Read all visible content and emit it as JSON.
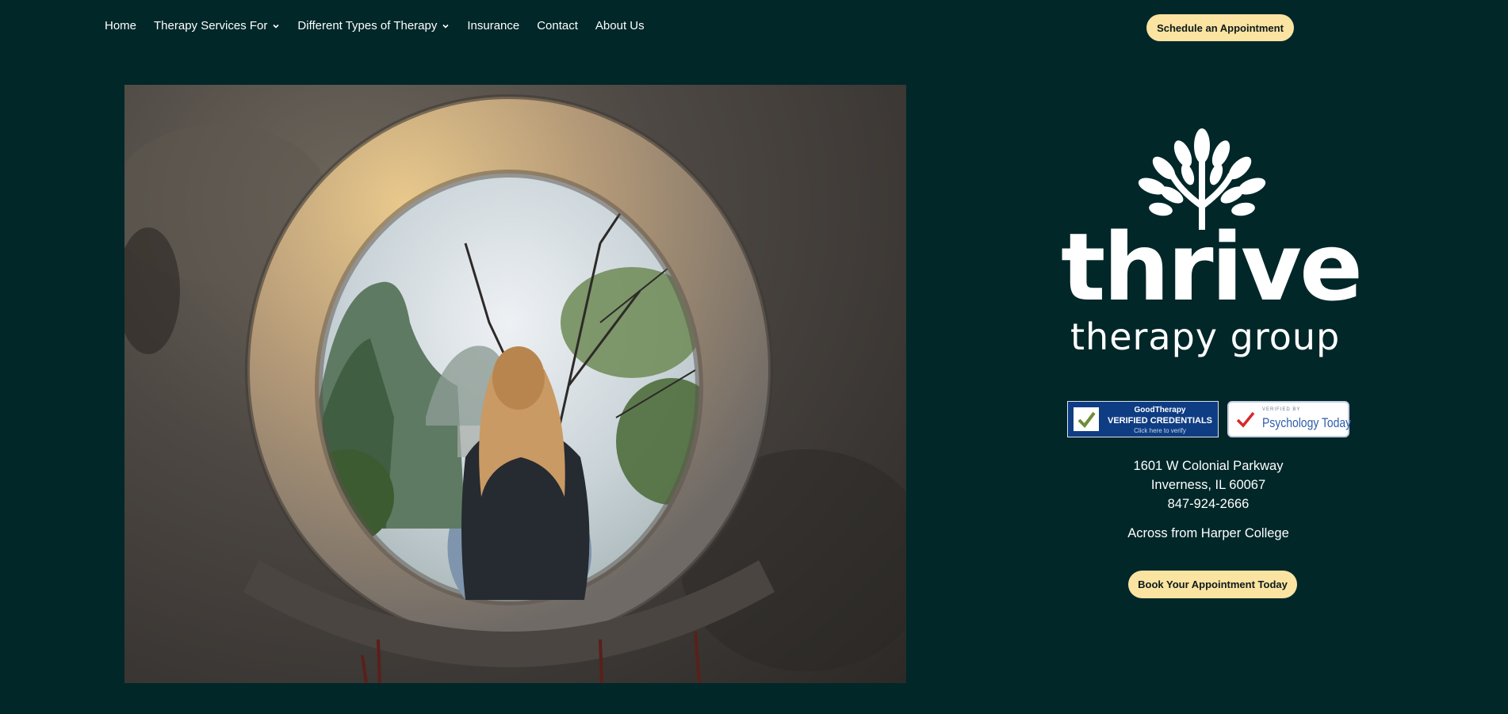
{
  "nav": {
    "items": [
      {
        "label": "Home",
        "dropdown": false
      },
      {
        "label": "Therapy Services For",
        "dropdown": true
      },
      {
        "label": "Different Types of Therapy",
        "dropdown": true
      },
      {
        "label": "Insurance",
        "dropdown": false
      },
      {
        "label": "Contact",
        "dropdown": false
      },
      {
        "label": "About Us",
        "dropdown": false
      }
    ],
    "cta_label": "Schedule an Appointment"
  },
  "brand": {
    "name": "thrive",
    "tagline": "therapy group"
  },
  "badges": {
    "goodtherapy": {
      "brand": "GoodTherapy",
      "title": "VERIFIED CREDENTIALS",
      "subtitle": "Click here to verify"
    },
    "psychology_today": {
      "pretitle": "VERIFIED BY",
      "title": "Psychology Today"
    }
  },
  "contact": {
    "street": "1601 W Colonial Parkway",
    "city": "Inverness, IL 60067",
    "phone": "847-924-2666",
    "landmark": "Across from Harper College"
  },
  "book_cta_label": "Book Your Appointment Today",
  "colors": {
    "background": "#012729",
    "cta": "#fbe3a1",
    "text": "#ffffff"
  }
}
